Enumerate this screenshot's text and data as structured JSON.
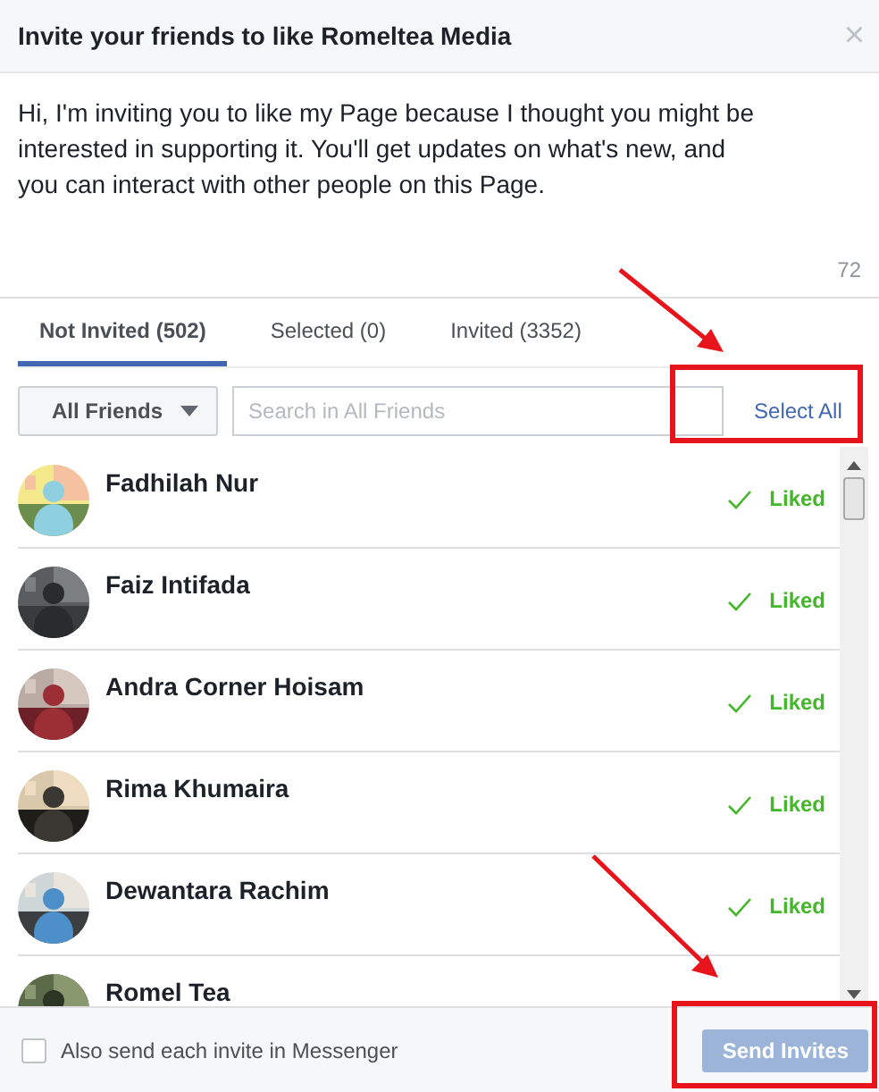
{
  "dialog": {
    "title": "Invite your friends to like Romeltea Media",
    "close": "×"
  },
  "message": {
    "value": "Hi, I'm inviting you to like my Page because I thought you might be interested in supporting it. You'll get updates on what's new, and you can interact with other people on this Page.",
    "counter": "72"
  },
  "tabs": [
    {
      "label": "Not Invited (502)",
      "selected": true
    },
    {
      "label": "Selected (0)",
      "selected": false
    },
    {
      "label": "Invited (3352)",
      "selected": false
    }
  ],
  "filter": {
    "label": "All Friends"
  },
  "search": {
    "placeholder": "Search in All Friends"
  },
  "select_all": {
    "label": "Select All",
    "highlighted": true,
    "pointed_at": true
  },
  "friends": [
    {
      "name": "Fadhilah Nur",
      "status": "Liked"
    },
    {
      "name": "Faiz Intifada",
      "status": "Liked"
    },
    {
      "name": "Andra Corner Hoisam",
      "status": "Liked"
    },
    {
      "name": "Rima Khumaira",
      "status": "Liked"
    },
    {
      "name": "Dewantara Rachim",
      "status": "Liked"
    },
    {
      "name": "Romel Tea"
    }
  ],
  "footer": {
    "messenger_option": {
      "label": "Also send each invite in Messenger",
      "checked": false
    },
    "send_button": {
      "label": "Send Invites",
      "disabled": true,
      "highlighted": true,
      "pointed_at": true
    }
  }
}
